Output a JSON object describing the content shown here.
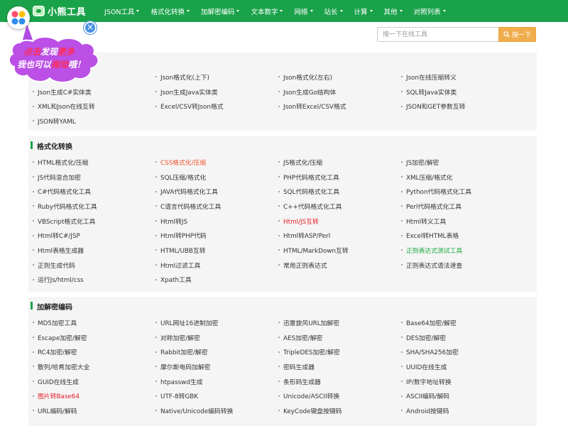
{
  "brand": {
    "name": "小熊工具"
  },
  "nav": [
    {
      "label": "JSON工具",
      "has_menu": true
    },
    {
      "label": "格式化转换",
      "has_menu": true
    },
    {
      "label": "加解密编码",
      "has_menu": true
    },
    {
      "label": "文本数字",
      "has_menu": true
    },
    {
      "label": "网络",
      "has_menu": true
    },
    {
      "label": "站长",
      "has_menu": true
    },
    {
      "label": "计算",
      "has_menu": true
    },
    {
      "label": "其他",
      "has_menu": true
    },
    {
      "label": "对照列表",
      "has_menu": true
    }
  ],
  "search": {
    "placeholder": "搜一下在线工具",
    "button_label": "搜一下"
  },
  "float_bubble": {
    "line1": [
      "点击",
      "发现",
      "更多"
    ],
    "line2": [
      "我也可以",
      "拖动",
      "哦！"
    ],
    "close_label": "×"
  },
  "colors": {
    "nav_bg": "#1aa24a",
    "accent_green": "#1aa24a",
    "search_button": "#f0ad4e",
    "highlight_orange": "#f0522b",
    "highlight_red": "#e2202a",
    "highlight_green": "#19a93e",
    "section_bg": "#f5f5f5"
  },
  "sections": [
    {
      "title": "",
      "items": [
        {
          "label": "",
          "style": "normal"
        },
        {
          "label": "Json格式化(上下)",
          "style": "normal"
        },
        {
          "label": "Json格式化(左右)",
          "style": "normal"
        },
        {
          "label": "Json在线压缩转义",
          "style": "normal"
        },
        {
          "label": "Json生成C#实体类",
          "style": "normal"
        },
        {
          "label": "Json生成Java实体类",
          "style": "normal"
        },
        {
          "label": "Json生成Go结构体",
          "style": "normal"
        },
        {
          "label": "SQL转Java实体类",
          "style": "normal"
        },
        {
          "label": "XML和Json在线互转",
          "style": "normal"
        },
        {
          "label": "Excel/CSV转Json格式",
          "style": "normal"
        },
        {
          "label": "Json转Excel/CSV格式",
          "style": "normal"
        },
        {
          "label": "JSON和GET参数互转",
          "style": "normal"
        },
        {
          "label": "JSON转YAML",
          "style": "normal"
        }
      ]
    },
    {
      "title": "格式化转换",
      "items": [
        {
          "label": "HTML格式化/压缩",
          "style": "normal"
        },
        {
          "label": "CSS格式化/压缩",
          "style": "orange"
        },
        {
          "label": "JS格式化/压缩",
          "style": "normal"
        },
        {
          "label": "JS加密/解密",
          "style": "normal"
        },
        {
          "label": "JS代码混合加密",
          "style": "normal"
        },
        {
          "label": "SQL压缩/格式化",
          "style": "normal"
        },
        {
          "label": "PHP代码格式化工具",
          "style": "normal"
        },
        {
          "label": "XML压缩/格式化",
          "style": "normal"
        },
        {
          "label": "C#代码格式化工具",
          "style": "normal"
        },
        {
          "label": "JAVA代码格式化工具",
          "style": "normal"
        },
        {
          "label": "SQL代码格式化工具",
          "style": "normal"
        },
        {
          "label": "Python代码格式化工具",
          "style": "normal"
        },
        {
          "label": "Ruby代码格式化工具",
          "style": "normal"
        },
        {
          "label": "C语言代码格式化工具",
          "style": "normal"
        },
        {
          "label": "C++代码格式化工具",
          "style": "normal"
        },
        {
          "label": "Perl代码格式化工具",
          "style": "normal"
        },
        {
          "label": "VBScript格式化工具",
          "style": "normal"
        },
        {
          "label": "Html转JS",
          "style": "normal"
        },
        {
          "label": "Html/JS互转",
          "style": "red"
        },
        {
          "label": "Html转义工具",
          "style": "normal"
        },
        {
          "label": "Html转C#/JSP",
          "style": "normal"
        },
        {
          "label": "Html转PHP代码",
          "style": "normal"
        },
        {
          "label": "Html转ASP/Perl",
          "style": "normal"
        },
        {
          "label": "Excel转HTML表格",
          "style": "normal"
        },
        {
          "label": "Html表格生成器",
          "style": "normal"
        },
        {
          "label": "HTML/UBB互转",
          "style": "normal"
        },
        {
          "label": "HTML/MarkDown互转",
          "style": "normal"
        },
        {
          "label": "正则表达式测试工具",
          "style": "green"
        },
        {
          "label": "正则生成代码",
          "style": "normal"
        },
        {
          "label": "Html过滤工具",
          "style": "normal"
        },
        {
          "label": "常用正则表达式",
          "style": "normal"
        },
        {
          "label": "正则表达式语法速查",
          "style": "normal"
        },
        {
          "label": "运行Js/html/css",
          "style": "normal"
        },
        {
          "label": "Xpath工具",
          "style": "normal"
        }
      ]
    },
    {
      "title": "加解密编码",
      "items": [
        {
          "label": "MD5加密工具",
          "style": "normal"
        },
        {
          "label": "URL网址16进制加密",
          "style": "normal"
        },
        {
          "label": "迅雷旋风URL加解密",
          "style": "normal"
        },
        {
          "label": "Base64加密/解密",
          "style": "normal"
        },
        {
          "label": "Escape加密/解密",
          "style": "normal"
        },
        {
          "label": "对称加密/解密",
          "style": "normal"
        },
        {
          "label": "AES加密/解密",
          "style": "normal"
        },
        {
          "label": "DES加密/解密",
          "style": "normal"
        },
        {
          "label": "RC4加密/解密",
          "style": "normal"
        },
        {
          "label": "Rabbit加密/解密",
          "style": "normal"
        },
        {
          "label": "TripleDES加密/解密",
          "style": "normal"
        },
        {
          "label": "SHA/SHA256加密",
          "style": "normal"
        },
        {
          "label": "散列/哈希加密大全",
          "style": "normal"
        },
        {
          "label": "摩尔斯电码加解密",
          "style": "normal"
        },
        {
          "label": "密码生成器",
          "style": "normal"
        },
        {
          "label": "UUID在线生成",
          "style": "normal"
        },
        {
          "label": "GUID在线生成",
          "style": "normal"
        },
        {
          "label": "htpasswd生成",
          "style": "normal"
        },
        {
          "label": "条形码生成器",
          "style": "normal"
        },
        {
          "label": "IP/数字地址转换",
          "style": "normal"
        },
        {
          "label": "图片转Base64",
          "style": "red"
        },
        {
          "label": "UTF-8转GBK",
          "style": "normal"
        },
        {
          "label": "Unicode/ASCII转换",
          "style": "normal"
        },
        {
          "label": "ASCII编码/解码",
          "style": "normal"
        },
        {
          "label": "URL编码/解码",
          "style": "normal"
        },
        {
          "label": "Native/Unicode编码转换",
          "style": "normal"
        },
        {
          "label": "KeyCode键盘按键码",
          "style": "normal"
        },
        {
          "label": "Android按键码",
          "style": "normal"
        },
        {
          "label": "",
          "style": "normal"
        }
      ]
    }
  ]
}
